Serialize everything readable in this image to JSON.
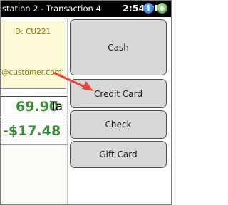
{
  "titlebar": {
    "title": "station 2 - Transaction 4",
    "time": "2:54 PM",
    "icons": [
      "info-icon",
      "network-icon"
    ]
  },
  "customer": {
    "id_text": "ID: CU221",
    "email_text": "@customer.com"
  },
  "totals": {
    "total_value": "69.90",
    "total_suffix": "Ta",
    "balance_value": "-$17.48"
  },
  "payment_buttons": {
    "cash": "Cash",
    "credit_card": "Credit Card",
    "check": "Check",
    "gift_card": "Gift Card"
  },
  "colors": {
    "accent_green": "#3a8a3a",
    "arrow_red": "#e8463c",
    "button_gray": "#d7d7d7"
  }
}
